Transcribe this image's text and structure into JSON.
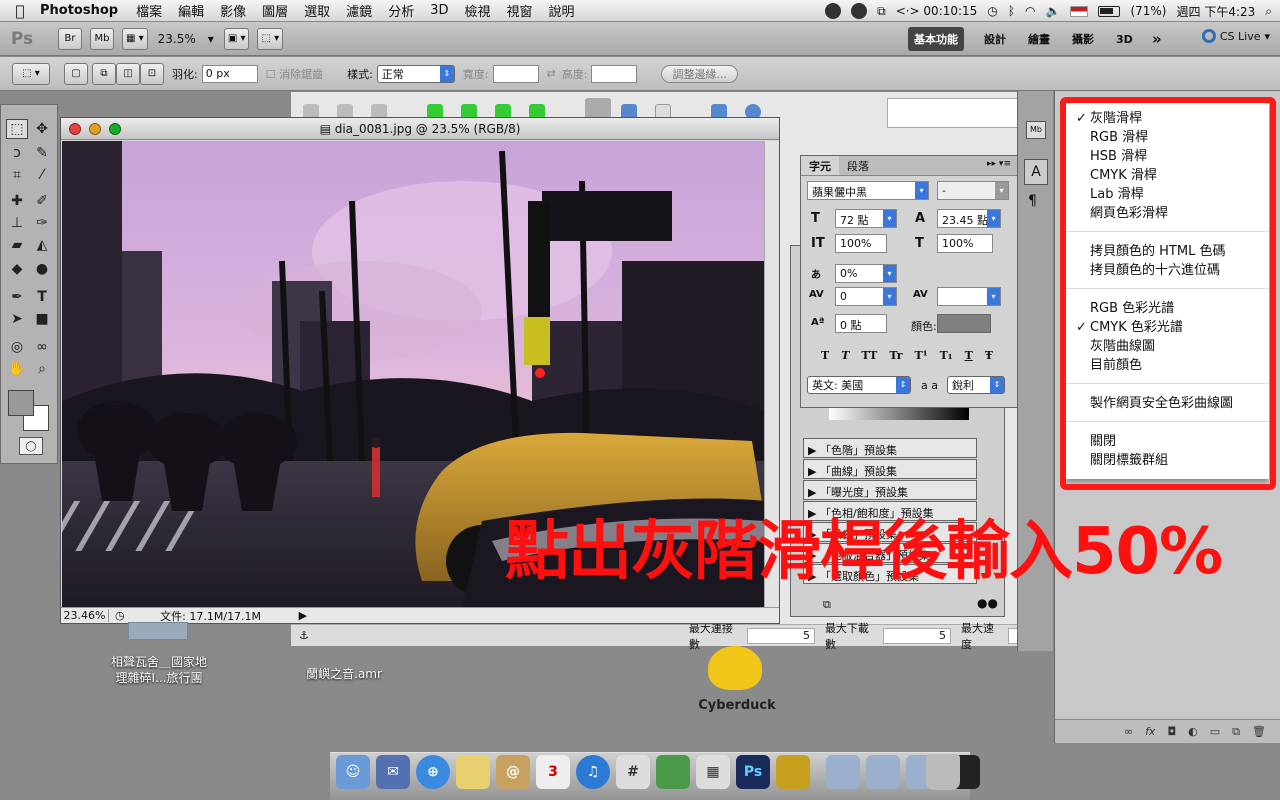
{
  "menubar": {
    "app_name": "Photoshop",
    "menus": [
      "檔案",
      "編輯",
      "影像",
      "圖層",
      "選取",
      "濾鏡",
      "分析",
      "3D",
      "檢視",
      "視窗",
      "說明"
    ],
    "timer": "<·> 00:10:15",
    "battery": "(71%)",
    "clock": "週四 下午4:23"
  },
  "appbar": {
    "logo": "Ps",
    "bridge": "Br",
    "minibridge": "Mb",
    "zoom": "23.5%",
    "workspaces": [
      "基本功能",
      "設計",
      "繪畫",
      "攝影",
      "3D"
    ],
    "more": "»",
    "cs_live": "CS Live"
  },
  "options": {
    "feather_label": "羽化:",
    "feather_value": "0 px",
    "antialias_label": "消除鋸齒",
    "style_label": "樣式:",
    "style_value": "正常",
    "width_label": "寬度:",
    "height_label": "高度:",
    "refine_button": "調整邊緣..."
  },
  "document": {
    "title": "dia_0081.jpg @ 23.5% (RGB/8)",
    "zoom": "23.46%",
    "file_info": "文件: 17.1M/17.1M"
  },
  "char_panel": {
    "tabs": [
      "字元",
      "段落"
    ],
    "font_family": "蘋果儷中黑",
    "font_style": "-",
    "font_size": "72 點",
    "leading": "23.45 點",
    "vertical_scale": "100%",
    "horizontal_scale": "100%",
    "tsume": "0%",
    "kerning": "0",
    "tracking": "",
    "baseline": "0 點",
    "color_label": "顏色:",
    "language": "英文: 美國",
    "aa_icon": "a a",
    "antialias": "銳利",
    "style_buttons": [
      "T",
      "T",
      "TT",
      "Tr",
      "T¹",
      "T₁",
      "T",
      "Ŧ"
    ]
  },
  "adjust_panel": {
    "presets": [
      "「色階」預設集",
      "「曲線」預設集",
      "「曝光度」預設集",
      "「色相/飽和度」預設集",
      "「黑白」預設集",
      "「色版混合器」預設集",
      "「選取顏色」預設集"
    ]
  },
  "bg_window": {
    "status": [
      {
        "label": "最大連接數",
        "value": "5"
      },
      {
        "label": "最大下載數",
        "value": "5"
      },
      {
        "label": "最大速度",
        "value": ""
      }
    ]
  },
  "flyout": {
    "items": [
      {
        "label": "灰階滑桿",
        "checked": true
      },
      {
        "label": "RGB 滑桿",
        "checked": false
      },
      {
        "label": "HSB 滑桿",
        "checked": false
      },
      {
        "label": "CMYK 滑桿",
        "checked": false
      },
      {
        "label": "Lab 滑桿",
        "checked": false
      },
      {
        "label": "網頁色彩滑桿",
        "checked": false
      },
      {
        "label": "拷貝顏色的 HTML 色碼",
        "checked": false
      },
      {
        "label": "拷貝顏色的十六進位碼",
        "checked": false
      },
      {
        "label": "RGB 色彩光譜",
        "checked": false
      },
      {
        "label": "CMYK 色彩光譜",
        "checked": true
      },
      {
        "label": "灰階曲線圖",
        "checked": false
      },
      {
        "label": "目前顏色",
        "checked": false
      },
      {
        "label": "製作網頁安全色彩曲線圖",
        "checked": false
      },
      {
        "label": "關閉",
        "checked": false
      },
      {
        "label": "關閉標籤群組",
        "checked": false
      }
    ],
    "check_mark": "✓"
  },
  "annotation": "點出灰階滑桿後輸入50%",
  "desktop": {
    "icon1_label_line1": "相聲瓦舍＿國家地",
    "icon1_label_line2": "理雜碎I...旅行團",
    "icon2_label": "蘭嶼之音.amr",
    "icon3_label": "Cyberduck"
  },
  "colors": {
    "highlight": "#ff1a1a",
    "annotation": "#ff1010",
    "accent": "#3b77d8"
  }
}
